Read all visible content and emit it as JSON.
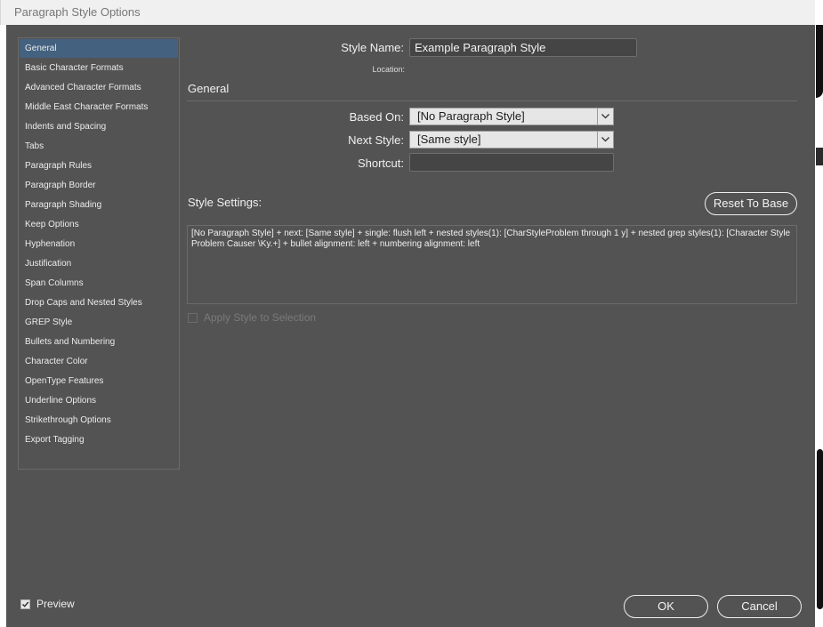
{
  "window": {
    "title": "Paragraph Style Options"
  },
  "sidebar": {
    "items": [
      {
        "label": "General",
        "selected": true
      },
      {
        "label": "Basic Character Formats"
      },
      {
        "label": "Advanced Character Formats"
      },
      {
        "label": "Middle East Character Formats"
      },
      {
        "label": "Indents and Spacing"
      },
      {
        "label": "Tabs"
      },
      {
        "label": "Paragraph Rules"
      },
      {
        "label": "Paragraph Border"
      },
      {
        "label": "Paragraph Shading"
      },
      {
        "label": "Keep Options"
      },
      {
        "label": "Hyphenation"
      },
      {
        "label": "Justification"
      },
      {
        "label": "Span Columns"
      },
      {
        "label": "Drop Caps and Nested Styles"
      },
      {
        "label": "GREP Style"
      },
      {
        "label": "Bullets and Numbering"
      },
      {
        "label": "Character Color"
      },
      {
        "label": "OpenType Features"
      },
      {
        "label": "Underline Options"
      },
      {
        "label": "Strikethrough Options"
      },
      {
        "label": "Export Tagging"
      }
    ]
  },
  "general": {
    "style_name_label": "Style Name:",
    "style_name_value": "Example Paragraph Style",
    "location_label": "Location:",
    "section_title": "General",
    "based_on_label": "Based On:",
    "based_on_value": "[No Paragraph Style]",
    "next_style_label": "Next Style:",
    "next_style_value": "[Same style]",
    "shortcut_label": "Shortcut:",
    "shortcut_value": "",
    "style_settings_label": "Style Settings:",
    "reset_button": "Reset To Base",
    "style_settings_text": "[No Paragraph Style] + next: [Same style] + single: flush left + nested styles(1): [CharStyleProblem through 1 y] + nested grep styles(1): [Character Style Problem Causer \\Ky.+] +  bullet alignment: left +  numbering alignment: left",
    "apply_style_label": "Apply Style to Selection",
    "apply_style_checked": false
  },
  "footer": {
    "preview_label": "Preview",
    "preview_checked": true,
    "ok_label": "OK",
    "cancel_label": "Cancel"
  },
  "colors": {
    "dialog_bg": "#535353",
    "selection": "#44627f"
  },
  "icons": {
    "dropdown": "chevron-down-icon",
    "check": "checkmark-icon"
  }
}
